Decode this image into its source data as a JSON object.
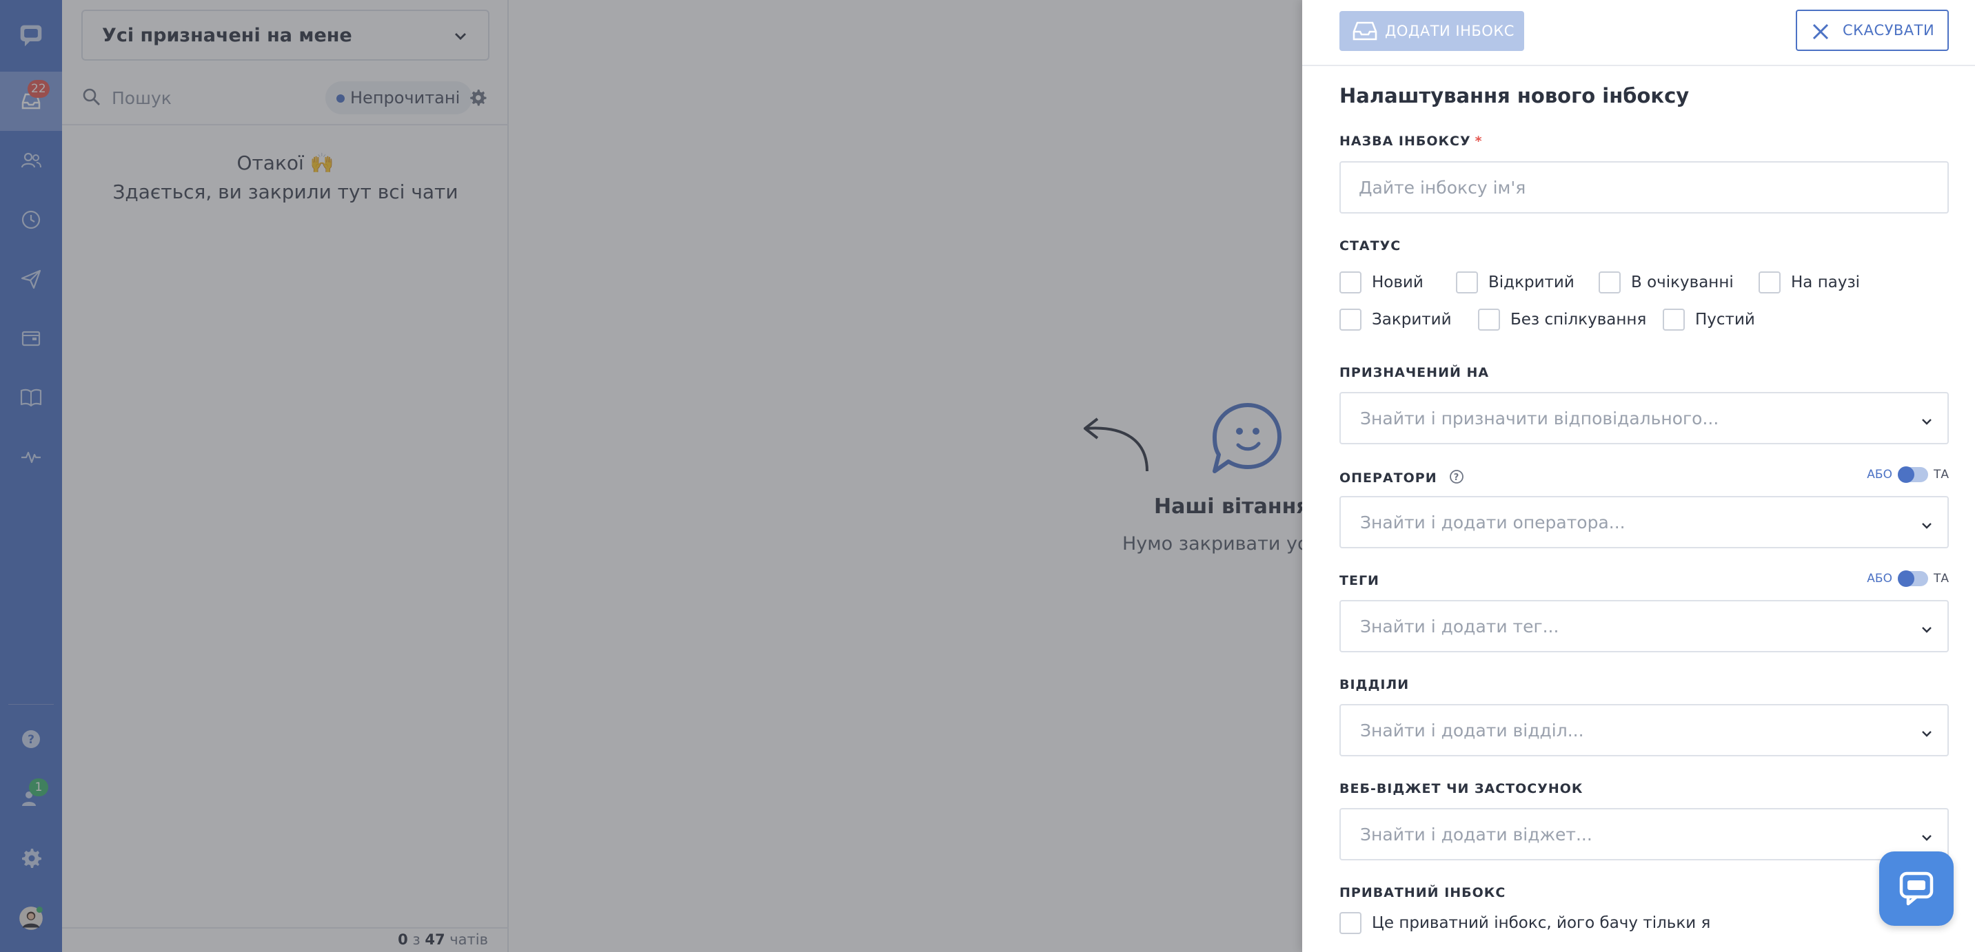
{
  "sidebar": {
    "inbox_badge": "22",
    "contacts_badge": "1"
  },
  "chat_list": {
    "filter_label": "Усі призначені на мене",
    "search_placeholder": "Пошук",
    "unread_label": "Непрочитані",
    "empty_title": "Отакої 🙌",
    "empty_subtitle": "Здається, ви закрили тут всі чати",
    "count_shown": "0",
    "count_of": "з",
    "count_total": "47",
    "count_unit": "чатів"
  },
  "main": {
    "welcome_title": "Наші вітання, А",
    "welcome_subtitle": "Нумо закривати усі ці"
  },
  "drawer": {
    "add_button": "ДОДАТИ ІНБОКС",
    "cancel_button": "СКАСУВАТИ",
    "title": "Налаштування нового інбоксу",
    "name_label": "НАЗВА ІНБОКСУ",
    "name_required_mark": "*",
    "name_placeholder": "Дайте інбоксу ім'я",
    "status_label": "СТАТУС",
    "statuses": [
      "Новий",
      "Відкритий",
      "В очікуванні",
      "На паузі",
      "Закритий",
      "Без спілкування",
      "Пустий"
    ],
    "assignee_label": "ПРИЗНАЧЕНИЙ НА",
    "assignee_placeholder": "Знайти і призначити відповідального...",
    "operators_label": "ОПЕРАТОРИ",
    "operators_placeholder": "Знайти і додати оператора...",
    "tags_label": "ТЕГИ",
    "tags_placeholder": "Знайти і додати тег...",
    "departments_label": "ВІДДІЛИ",
    "departments_placeholder": "Знайти і додати відділ...",
    "widget_label": "ВЕБ-ВІДЖЕТ ЧИ ЗАСТОСУНОК",
    "widget_placeholder": "Знайти і додати віджет...",
    "private_label": "ПРИВАТНИЙ ІНБОКС",
    "private_checkbox": "Це приватний інбокс, його бачу тільки я",
    "toggle_or": "АБО",
    "toggle_and": "ТА"
  },
  "colors": {
    "accent": "#4c72c4",
    "badge_red": "#e4564f",
    "badge_green": "#3cb46e"
  }
}
